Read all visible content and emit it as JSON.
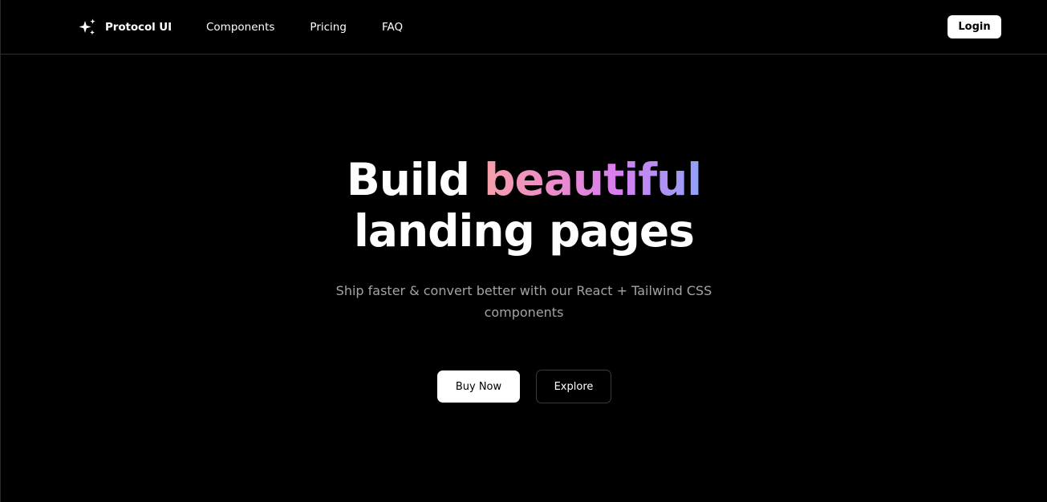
{
  "header": {
    "brand": {
      "name": "Protocol UI",
      "icon": "sparkles-icon"
    },
    "nav": [
      {
        "label": "Components"
      },
      {
        "label": "Pricing"
      },
      {
        "label": "FAQ"
      }
    ],
    "login_label": "Login"
  },
  "hero": {
    "title_prefix": "Build",
    "title_highlight": "beautiful",
    "title_line2": "landing pages",
    "subtitle": "Ship faster & convert better with our React + Tailwind CSS components",
    "primary_cta": "Buy Now",
    "secondary_cta": "Explore"
  },
  "colors": {
    "background": "#000000",
    "text": "#ffffff",
    "muted_text": "#a3a3a3",
    "divider": "#2e2e2e",
    "gradient": [
      "#f4a0a8",
      "#ee8cc8",
      "#d77ef0",
      "#8fa2f8"
    ]
  }
}
